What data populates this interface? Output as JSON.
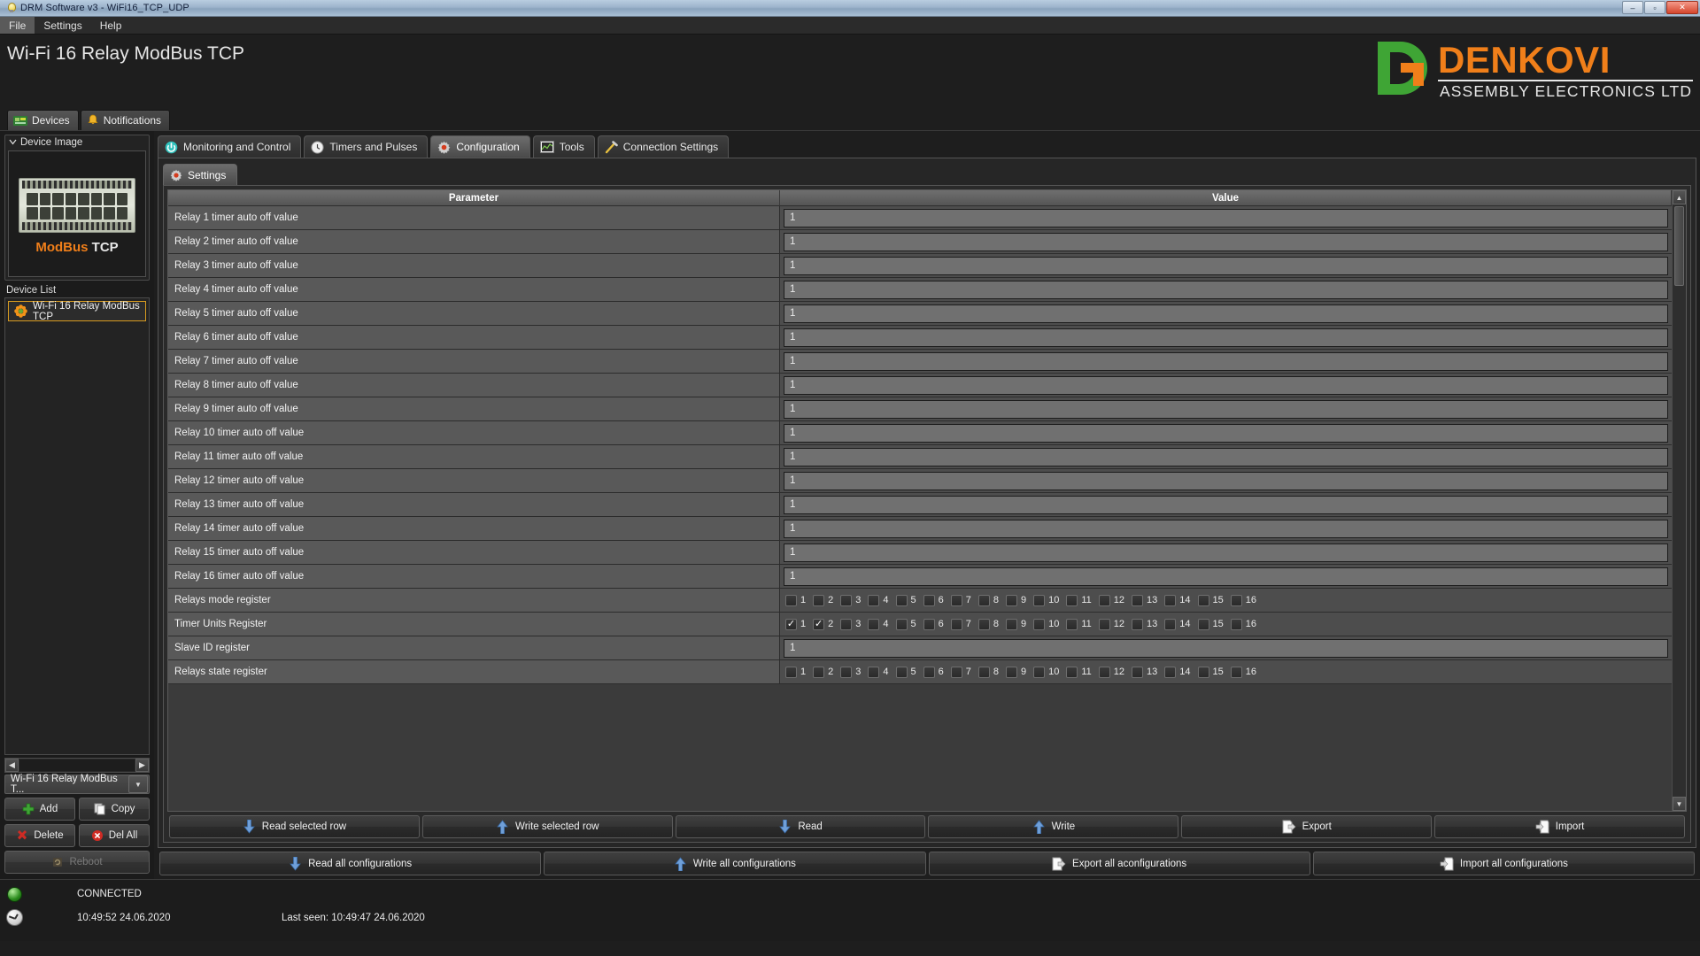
{
  "window": {
    "title": "DRM Software v3 - WiFi16_TCP_UDP",
    "minimize": "–",
    "maximize": "▫",
    "close": "✕"
  },
  "menu": [
    {
      "label": "File",
      "active": true
    },
    {
      "label": "Settings",
      "active": false
    },
    {
      "label": "Help",
      "active": false
    }
  ],
  "header": {
    "app_title": "Wi-Fi 16 Relay ModBus TCP",
    "logo_letter": "D",
    "logo_brand": "DENKOVI",
    "logo_sub": "ASSEMBLY ELECTRONICS LTD",
    "logo_color": "#f07f1a",
    "logo_green": "#3fa535"
  },
  "outer_tabs": [
    {
      "label": "Devices",
      "icon": "board-icon",
      "selected": true
    },
    {
      "label": "Notifications",
      "icon": "bell-icon",
      "selected": false
    }
  ],
  "left_panel": {
    "device_image_group": "Device Image",
    "device_image_caption_bold": "ModBus",
    "device_image_caption_rest": " TCP",
    "device_list_label": "Device List",
    "devices": [
      {
        "name": "Wi-Fi 16 Relay ModBus TCP",
        "icon": "flower-icon",
        "selected": true
      }
    ],
    "combo_value": "Wi-Fi 16 Relay ModBus T...",
    "buttons": [
      {
        "label": "Add",
        "icon": "plus-icon",
        "enabled": true
      },
      {
        "label": "Copy",
        "icon": "copy-icon",
        "enabled": true
      },
      {
        "label": "Delete",
        "icon": "x-red-icon",
        "enabled": true
      },
      {
        "label": "Del All",
        "icon": "delete-all-icon",
        "enabled": true
      },
      {
        "label": "Reboot",
        "icon": "reboot-icon",
        "enabled": false
      }
    ]
  },
  "main_tabs": [
    {
      "label": "Monitoring and Control",
      "icon": "power-icon",
      "selected": false
    },
    {
      "label": "Timers and Pulses",
      "icon": "clock-icon",
      "selected": false
    },
    {
      "label": "Configuration",
      "icon": "gear-red-icon",
      "selected": true
    },
    {
      "label": "Tools",
      "icon": "chart-icon",
      "selected": false
    },
    {
      "label": "Connection Settings",
      "icon": "hammer-icon",
      "selected": false
    }
  ],
  "sub_tabs": [
    {
      "label": "Settings",
      "icon": "gear-red-icon",
      "selected": true
    }
  ],
  "table": {
    "headers": {
      "parameter": "Parameter",
      "value": "Value"
    },
    "rows": [
      {
        "parameter": "Relay 1 timer auto off value",
        "type": "text",
        "value": "1"
      },
      {
        "parameter": "Relay 2 timer auto off value",
        "type": "text",
        "value": "1"
      },
      {
        "parameter": "Relay 3 timer auto off value",
        "type": "text",
        "value": "1"
      },
      {
        "parameter": "Relay 4 timer auto off value",
        "type": "text",
        "value": "1"
      },
      {
        "parameter": "Relay 5 timer auto off value",
        "type": "text",
        "value": "1"
      },
      {
        "parameter": "Relay 6 timer auto off value",
        "type": "text",
        "value": "1"
      },
      {
        "parameter": "Relay 7 timer auto off value",
        "type": "text",
        "value": "1"
      },
      {
        "parameter": "Relay 8 timer auto off value",
        "type": "text",
        "value": "1"
      },
      {
        "parameter": "Relay 9 timer auto off value",
        "type": "text",
        "value": "1"
      },
      {
        "parameter": "Relay 10 timer auto off value",
        "type": "text",
        "value": "1"
      },
      {
        "parameter": "Relay 11 timer auto off value",
        "type": "text",
        "value": "1"
      },
      {
        "parameter": "Relay 12 timer auto off value",
        "type": "text",
        "value": "1"
      },
      {
        "parameter": "Relay 13 timer auto off value",
        "type": "text",
        "value": "1"
      },
      {
        "parameter": "Relay 14 timer auto off value",
        "type": "text",
        "value": "1"
      },
      {
        "parameter": "Relay 15 timer auto off value",
        "type": "text",
        "value": "1"
      },
      {
        "parameter": "Relay 16 timer auto off value",
        "type": "text",
        "value": "1"
      },
      {
        "parameter": "Relays mode register",
        "type": "checkboxes",
        "labels": [
          "1",
          "2",
          "3",
          "4",
          "5",
          "6",
          "7",
          "8",
          "9",
          "10",
          "11",
          "12",
          "13",
          "14",
          "15",
          "16"
        ],
        "checked": []
      },
      {
        "parameter": "Timer Units Register",
        "type": "checkboxes",
        "labels": [
          "1",
          "2",
          "3",
          "4",
          "5",
          "6",
          "7",
          "8",
          "9",
          "10",
          "11",
          "12",
          "13",
          "14",
          "15",
          "16"
        ],
        "checked": [
          1,
          2
        ]
      },
      {
        "parameter": "Slave ID register",
        "type": "text",
        "value": "1"
      },
      {
        "parameter": "Relays state register",
        "type": "checkboxes",
        "labels": [
          "1",
          "2",
          "3",
          "4",
          "5",
          "6",
          "7",
          "8",
          "9",
          "10",
          "11",
          "12",
          "13",
          "14",
          "15",
          "16"
        ],
        "checked": []
      }
    ],
    "checkmark": "✓"
  },
  "action_bar_row": [
    {
      "label": "Read selected row",
      "icon": "download-arrow-icon"
    },
    {
      "label": "Write selected row",
      "icon": "upload-arrow-icon"
    },
    {
      "label": "Read",
      "icon": "download-arrow-icon"
    },
    {
      "label": "Write",
      "icon": "upload-arrow-icon"
    },
    {
      "label": "Export",
      "icon": "export-icon"
    },
    {
      "label": "Import",
      "icon": "import-icon"
    }
  ],
  "action_bar_all": [
    {
      "label": "Read all configurations",
      "icon": "download-arrow-icon"
    },
    {
      "label": "Write all configurations",
      "icon": "upload-arrow-icon"
    },
    {
      "label": "Export all aconfigurations",
      "icon": "export-icon"
    },
    {
      "label": "Import all configurations",
      "icon": "import-icon"
    }
  ],
  "status_bar": {
    "connection": "CONNECTED",
    "time": "10:49:52 24.06.2020",
    "last_seen": "Last seen: 10:49:47 24.06.2020"
  }
}
